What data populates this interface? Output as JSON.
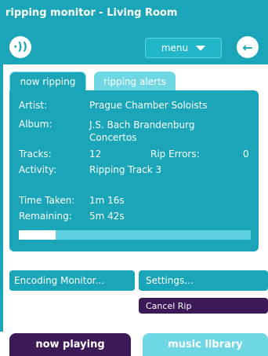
{
  "app": {
    "title": "ripping monitor - Living Room"
  },
  "header": {
    "menu_label": "menu",
    "speaker_glyph": "·))",
    "back_glyph": "←"
  },
  "tabs": {
    "now_ripping": "now ripping",
    "ripping_alerts": "ripping alerts"
  },
  "rip": {
    "artist_label": "Artist:",
    "artist": "Prague Chamber Soloists",
    "album_label": "Album:",
    "album": "J.S. Bach Brandenburg Concertos",
    "tracks_label": "Tracks:",
    "tracks": "12",
    "rip_errors_label": "Rip Errors:",
    "rip_errors": "0",
    "activity_label": "Activity:",
    "activity": "Ripping Track 3",
    "time_taken_label": "Time Taken:",
    "time_taken": "1m 16s",
    "remaining_label": "Remaining:",
    "remaining": "5m 42s",
    "progress_fraction": 0.16
  },
  "actions": {
    "encoding_monitor": "Encoding Monitor...",
    "settings": "Settings...",
    "cancel_rip": "Cancel Rip"
  },
  "bottom_tabs": {
    "now_playing": "now playing",
    "music_library": "music library"
  },
  "colors": {
    "teal": "#1aa6b8",
    "light_teal": "#6ed7e3",
    "purple": "#3b1a57"
  },
  "icons": {
    "speaker": "speaker-icon",
    "back": "back-arrow-icon",
    "menu_caret": "caret-down-icon"
  }
}
